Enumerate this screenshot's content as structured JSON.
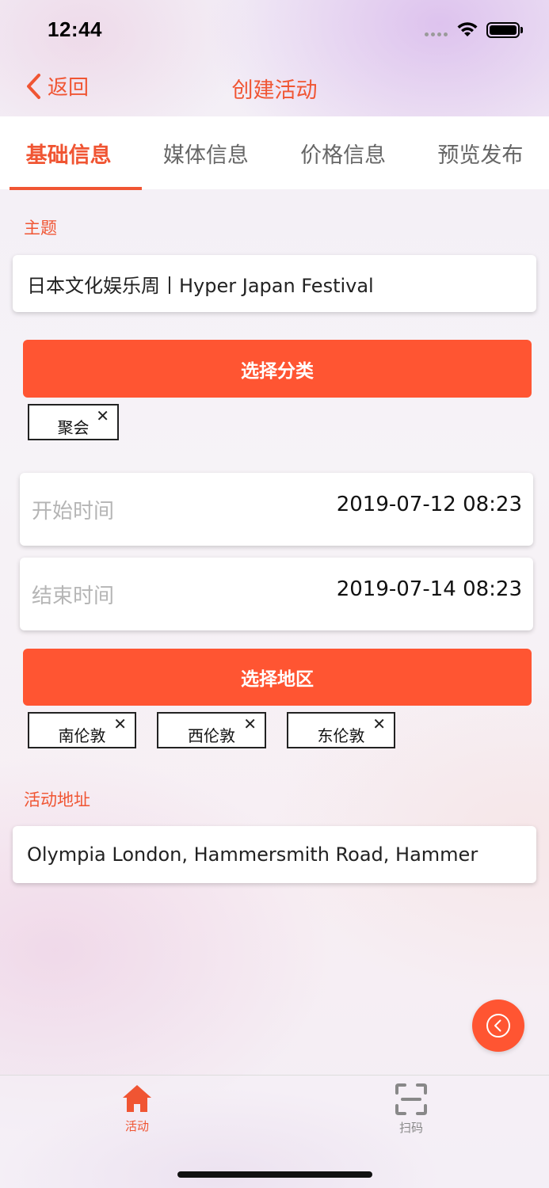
{
  "status_bar": {
    "time": "12:44"
  },
  "nav": {
    "back_label": "返回",
    "title": "创建活动"
  },
  "tabs": [
    {
      "label": "基础信息",
      "active": true
    },
    {
      "label": "媒体信息",
      "active": false
    },
    {
      "label": "价格信息",
      "active": false
    },
    {
      "label": "预览发布",
      "active": false
    }
  ],
  "form": {
    "topic_label": "主题",
    "topic_value": "日本文化娱乐周丨Hyper Japan Festival",
    "category_button": "选择分类",
    "category_tags": [
      "聚会"
    ],
    "start_time": {
      "label": "开始时间",
      "value": "2019-07-12 08:23"
    },
    "end_time": {
      "label": "结束时间",
      "value": "2019-07-14 08:23"
    },
    "region_button": "选择地区",
    "region_tags": [
      "南伦敦",
      "西伦敦",
      "东伦敦"
    ],
    "address_label": "活动地址",
    "address_value": "Olympia London, Hammersmith Road, Hammer"
  },
  "tabbar": [
    {
      "label": "活动",
      "icon": "home-icon",
      "active": true
    },
    {
      "label": "扫码",
      "icon": "scan-icon",
      "active": false
    }
  ],
  "colors": {
    "accent": "#f05533",
    "button": "#ff5532",
    "inactive": "#888888"
  }
}
